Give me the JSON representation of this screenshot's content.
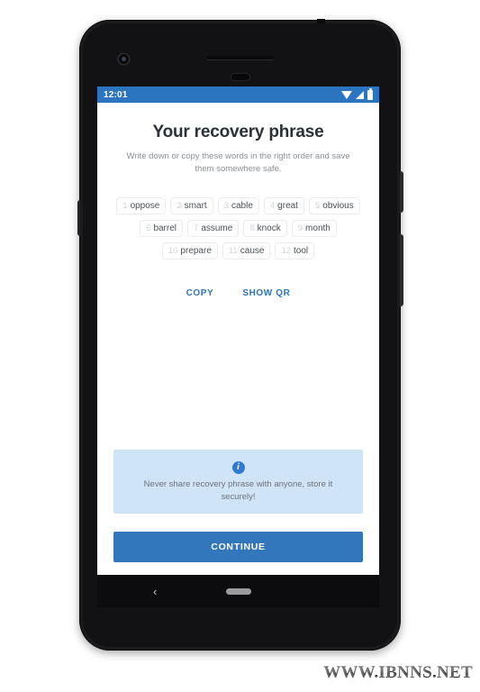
{
  "device": {
    "frame_color": "#1b1b1d",
    "icons": {
      "camera": "front-camera",
      "earpiece": "earpiece-speaker",
      "sensor": "proximity-sensor"
    }
  },
  "status_bar": {
    "time": "12:01",
    "background": "#2a74c0",
    "icons": [
      "wifi-icon",
      "signal-icon",
      "battery-icon"
    ]
  },
  "screen": {
    "title": "Your recovery phrase",
    "subtitle": "Write down or copy these words in the right order and save them somewhere safe.",
    "recovery_words": [
      [
        {
          "index": "1",
          "word": "oppose"
        },
        {
          "index": "2",
          "word": "smart"
        },
        {
          "index": "3",
          "word": "cable"
        },
        {
          "index": "4",
          "word": "great"
        },
        {
          "index": "5",
          "word": "obvious"
        }
      ],
      [
        {
          "index": "6",
          "word": "barrel"
        },
        {
          "index": "7",
          "word": "assume"
        },
        {
          "index": "8",
          "word": "knock"
        },
        {
          "index": "9",
          "word": "month"
        }
      ],
      [
        {
          "index": "10",
          "word": "prepare"
        },
        {
          "index": "11",
          "word": "cause"
        },
        {
          "index": "12",
          "word": "tool"
        }
      ]
    ],
    "actions": {
      "copy_label": "COPY",
      "show_qr_label": "SHOW QR",
      "link_color": "#3273b8"
    },
    "info_banner": {
      "icon": "info-icon",
      "icon_glyph": "i",
      "text": "Never share recovery phrase with anyone, store it securely!",
      "background": "#cfe4f7",
      "icon_color": "#2e7ad1"
    },
    "continue_button": {
      "label": "CONTINUE",
      "background": "#3277bb",
      "text_color": "#ffffff"
    }
  },
  "nav_bar": {
    "back_glyph": "‹",
    "back_label": "back-button",
    "home_label": "home-indicator"
  },
  "watermark": {
    "text": "WWW.IBNNS.NET"
  }
}
